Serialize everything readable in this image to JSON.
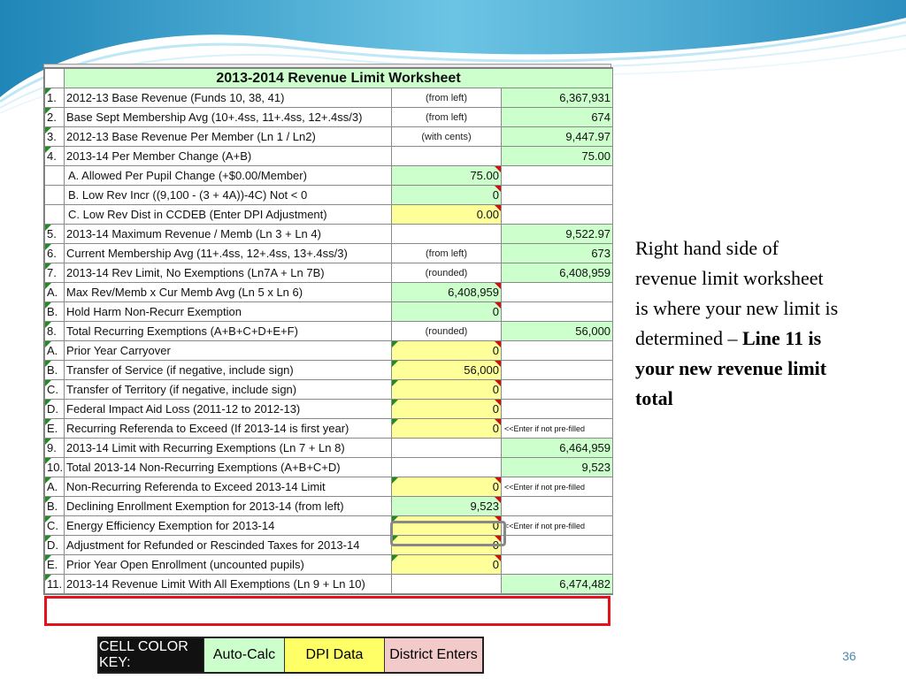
{
  "title": "2013-2014 Revenue Limit Worksheet",
  "rows": [
    {
      "num": "1.",
      "desc": "2012-13 Base Revenue (Funds 10, 38, 41)",
      "mid": "(from left)",
      "right": "6,367,931",
      "mid_style": "note",
      "right_color": "g"
    },
    {
      "num": "2.",
      "desc": "Base Sept Membership Avg  (10+.4ss, 11+.4ss, 12+.4ss/3)",
      "mid": "(from left)",
      "right": "674",
      "mid_style": "note",
      "right_color": "g"
    },
    {
      "num": "3.",
      "desc": "2012-13 Base Revenue Per Member (Ln 1 / Ln2)",
      "mid": "(with cents)",
      "right": "9,447.97",
      "mid_style": "note",
      "right_color": "g"
    },
    {
      "num": "4.",
      "desc": "2013-14 Per Member Change   (A+B)",
      "mid": "",
      "right": "75.00",
      "right_color": "g"
    },
    {
      "num": "",
      "desc": "A. Allowed Per Pupil Change (+$0.00/Member)",
      "mid": "75.00",
      "right": "",
      "mid_color": "g",
      "sub": true
    },
    {
      "num": "",
      "desc": "B. Low Rev Incr ((9,100 - (3 + 4A))-4C) Not < 0",
      "mid": "0",
      "right": "",
      "mid_color": "g",
      "sub": true
    },
    {
      "num": "",
      "desc": "C. Low Rev Dist in CCDEB (Enter DPI Adjustment)",
      "mid": "0.00",
      "right": "",
      "mid_color": "y",
      "sub": true
    },
    {
      "num": "5.",
      "desc": "2013-14 Maximum Revenue / Memb (Ln 3 + Ln 4)",
      "mid": "",
      "right": "9,522.97",
      "right_color": "g"
    },
    {
      "num": "6.",
      "desc": "Current Membership Avg  (11+.4ss, 12+.4ss, 13+.4ss/3)",
      "mid": "(from left)",
      "right": "673",
      "mid_style": "note",
      "right_color": "g"
    },
    {
      "num": "7.",
      "desc": "2013-14 Rev Limit, No Exemptions (Ln7A + Ln 7B)",
      "mid": "(rounded)",
      "right": "6,408,959",
      "mid_style": "note",
      "right_color": "g"
    },
    {
      "num": "A.",
      "desc": "Max Rev/Memb x Cur Memb Avg (Ln 5 x Ln 6)",
      "mid": "6,408,959",
      "right": "",
      "mid_color": "g"
    },
    {
      "num": "B.",
      "desc": "Hold Harm Non-Recurr Exemption",
      "mid": "0",
      "right": "",
      "mid_color": "g"
    },
    {
      "num": "8.",
      "desc": "Total Recurring Exemptions   (A+B+C+D+E+F)",
      "mid": "(rounded)",
      "right": "56,000",
      "mid_style": "note",
      "right_color": "g"
    },
    {
      "num": "A.",
      "desc": "Prior Year Carryover",
      "mid": "0",
      "right": "",
      "mid_color": "y"
    },
    {
      "num": "B.",
      "desc": "Transfer of Service    (if negative, include sign)",
      "mid": "56,000",
      "right": "",
      "mid_color": "y"
    },
    {
      "num": "C.",
      "desc": "Transfer of Territory   (if negative, include sign)",
      "mid": "0",
      "right": "",
      "mid_color": "y"
    },
    {
      "num": "D.",
      "desc": "Federal Impact Aid Loss  (2011-12 to 2012-13)",
      "mid": "0",
      "right": "",
      "mid_color": "y"
    },
    {
      "num": "E.",
      "desc": "Recurring Referenda to Exceed  (If 2013-14 is first year)",
      "mid": "0",
      "right": "<<Enter if not pre-filled",
      "mid_color": "y",
      "right_style": "small"
    },
    {
      "num": "9.",
      "desc": "2013-14 Limit with Recurring Exemptions   (Ln 7 + Ln 8)",
      "mid": "",
      "right": "6,464,959",
      "right_color": "g"
    },
    {
      "num": "10.",
      "desc": "Total 2013-14 Non-Recurring Exemptions  (A+B+C+D)",
      "mid": "",
      "right": "9,523",
      "right_color": "g"
    },
    {
      "num": "A.",
      "desc": "Non-Recurring Referenda to Exceed 2013-14 Limit",
      "mid": "0",
      "right": "<<Enter if not pre-filled",
      "mid_color": "y",
      "right_style": "small"
    },
    {
      "num": "B.",
      "desc": "Declining Enrollment Exemption for 2013-14 (from left)",
      "mid": "9,523",
      "right": "",
      "mid_color": "g"
    },
    {
      "num": "C.",
      "desc": "Energy Efficiency Exemption for 2013-14",
      "mid": "0",
      "right": "<<Enter if not pre-filled",
      "mid_color": "y",
      "right_style": "small"
    },
    {
      "num": "D.",
      "desc": "Adjustment for Refunded or Rescinded Taxes for 2013-14",
      "mid": "0",
      "right": "",
      "mid_color": "y"
    },
    {
      "num": "E.",
      "desc": "Prior Year Open Enrollment (uncounted pupils)",
      "mid": "0",
      "right": "",
      "mid_color": "y"
    },
    {
      "num": "11.",
      "desc": "2013-14 Revenue Limit With All Exemptions    (Ln 9 + Ln 10)",
      "mid": "",
      "right": "6,474,482",
      "right_color": "g"
    }
  ],
  "side_text": {
    "normal": "Right hand side of revenue limit worksheet is where your new limit is determined – ",
    "bold": "Line 11 is your new revenue limit total"
  },
  "color_key": {
    "label": "CELL COLOR KEY:",
    "auto_calc": "Auto-Calc",
    "dpi_data": "DPI Data",
    "district_enters": "District Enters"
  },
  "page_number": "36",
  "colors": {
    "auto_calc": "#ccffcc",
    "dpi_data": "#ffff99",
    "district_enters": "#f2caca",
    "highlight": "#e3121b"
  }
}
